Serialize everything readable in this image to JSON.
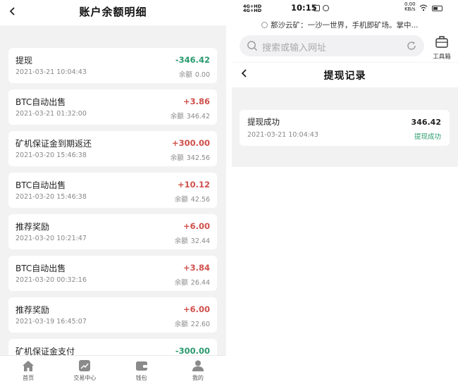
{
  "left": {
    "header": {
      "title": "账户余额明细"
    },
    "balance_label": "余额",
    "records": [
      {
        "title": "提现",
        "date": "2021-03-21 10:04:43",
        "amount": "-346.42",
        "sign": "neg",
        "balance": "0.00"
      },
      {
        "title": "BTC自动出售",
        "date": "2021-03-21 01:32:00",
        "amount": "+3.86",
        "sign": "pos",
        "balance": "346.42"
      },
      {
        "title": "矿机保证金到期返还",
        "date": "2021-03-20 15:46:38",
        "amount": "+300.00",
        "sign": "pos",
        "balance": "342.56"
      },
      {
        "title": "BTC自动出售",
        "date": "2021-03-20 15:46:38",
        "amount": "+10.12",
        "sign": "pos",
        "balance": "42.56"
      },
      {
        "title": "推荐奖励",
        "date": "2021-03-20 10:21:47",
        "amount": "+6.00",
        "sign": "pos",
        "balance": "32.44"
      },
      {
        "title": "BTC自动出售",
        "date": "2021-03-20 00:32:16",
        "amount": "+3.84",
        "sign": "pos",
        "balance": "26.44"
      },
      {
        "title": "推荐奖励",
        "date": "2021-03-19 16:45:07",
        "amount": "+6.00",
        "sign": "pos",
        "balance": "22.60"
      },
      {
        "title": "矿机保证金支付",
        "date": "",
        "amount": "-300.00",
        "sign": "neg",
        "balance": ""
      }
    ],
    "tabbar": [
      {
        "label": "首页",
        "icon": "home-icon"
      },
      {
        "label": "交易中心",
        "icon": "chart-icon"
      },
      {
        "label": "钱包",
        "icon": "wallet-icon"
      },
      {
        "label": "我的",
        "icon": "user-icon"
      }
    ]
  },
  "right": {
    "status": {
      "signal_top": "4G+HD",
      "signal_bottom": "4G+HD",
      "time": "10:15",
      "speed_value": "0.00",
      "speed_unit": "KB/s"
    },
    "ticker": "那沙云矿：一沙一世界，手机即矿场。掌中...",
    "search": {
      "placeholder": "搜索或输入网址"
    },
    "toolbox_label": "工具箱",
    "header": {
      "title": "提现记录"
    },
    "record": {
      "title": "提现成功",
      "date": "2021-03-21 10:04:43",
      "amount": "346.42",
      "status": "提现成功"
    }
  },
  "colors": {
    "positive": "#d0504c",
    "negative": "#2a9a6e",
    "success": "#2a9a6e",
    "background": "#f2f2f2"
  }
}
